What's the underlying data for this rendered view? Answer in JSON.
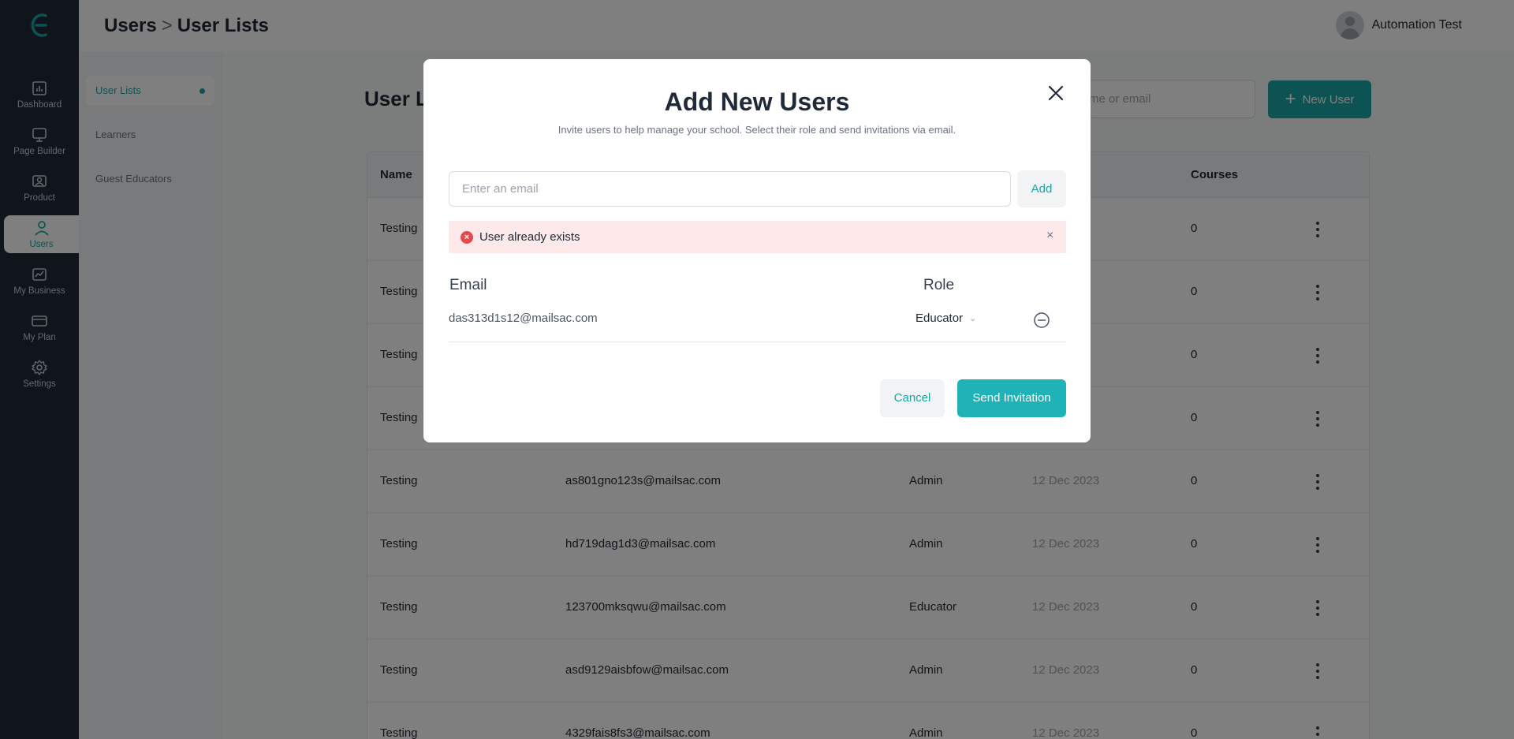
{
  "sidebar": {
    "items": [
      {
        "label": "Dashboard",
        "icon": "dashboard-icon"
      },
      {
        "label": "Page Builder",
        "icon": "monitor-icon"
      },
      {
        "label": "Product",
        "icon": "product-icon"
      },
      {
        "label": "Users",
        "icon": "user-icon",
        "active": true
      },
      {
        "label": "My Business",
        "icon": "chart-icon"
      },
      {
        "label": "My Plan",
        "icon": "card-icon"
      },
      {
        "label": "Settings",
        "icon": "gear-icon"
      }
    ]
  },
  "submenu": {
    "items": [
      {
        "label": "User Lists",
        "active": true
      },
      {
        "label": "Learners"
      },
      {
        "label": "Guest Educators"
      }
    ]
  },
  "header": {
    "crumb_root": "Users",
    "crumb_sep": ">",
    "crumb_current": "User Lists",
    "user_name": "Automation Test"
  },
  "main": {
    "title": "User L",
    "search_placeholder": "me or email",
    "new_user_label": "New User",
    "table": {
      "columns": [
        "Name",
        "Courses"
      ],
      "rows": [
        {
          "name": "Testing",
          "email": "",
          "role": "",
          "date": "23",
          "courses": "0"
        },
        {
          "name": "Testing",
          "email": "",
          "role": "",
          "date": "23",
          "courses": "0"
        },
        {
          "name": "Testing",
          "email": "",
          "role": "",
          "date": "23",
          "courses": "0"
        },
        {
          "name": "Testing",
          "email": "",
          "role": "",
          "date": "23",
          "courses": "0"
        },
        {
          "name": "Testing",
          "email": "as801gno123s@mailsac.com",
          "role": "Admin",
          "date": "12 Dec 2023",
          "courses": "0"
        },
        {
          "name": "Testing",
          "email": "hd719dag1d3@mailsac.com",
          "role": "Admin",
          "date": "12 Dec 2023",
          "courses": "0"
        },
        {
          "name": "Testing",
          "email": "123700mksqwu@mailsac.com",
          "role": "Educator",
          "date": "12 Dec 2023",
          "courses": "0"
        },
        {
          "name": "Testing",
          "email": "asd9129aisbfow@mailsac.com",
          "role": "Admin",
          "date": "12 Dec 2023",
          "courses": "0"
        },
        {
          "name": "Testing",
          "email": "4329fais8fs3@mailsac.com",
          "role": "Admin",
          "date": "12 Dec 2023",
          "courses": "0"
        }
      ]
    }
  },
  "modal": {
    "title": "Add New Users",
    "subtitle": "Invite users to help manage your school. Select their role and send invitations via email.",
    "email_placeholder": "Enter an email",
    "add_label": "Add",
    "alert_text": "User already exists",
    "col_email": "Email",
    "col_role": "Role",
    "entries": [
      {
        "email": "das313d1s12@mailsac.com",
        "role": "Educator"
      }
    ],
    "cancel_label": "Cancel",
    "send_label": "Send Invitation"
  },
  "colors": {
    "accent": "#1aa6a6",
    "rail_bg": "#1e2a36",
    "alert_bg": "#fde8ea",
    "error": "#e5484d"
  }
}
